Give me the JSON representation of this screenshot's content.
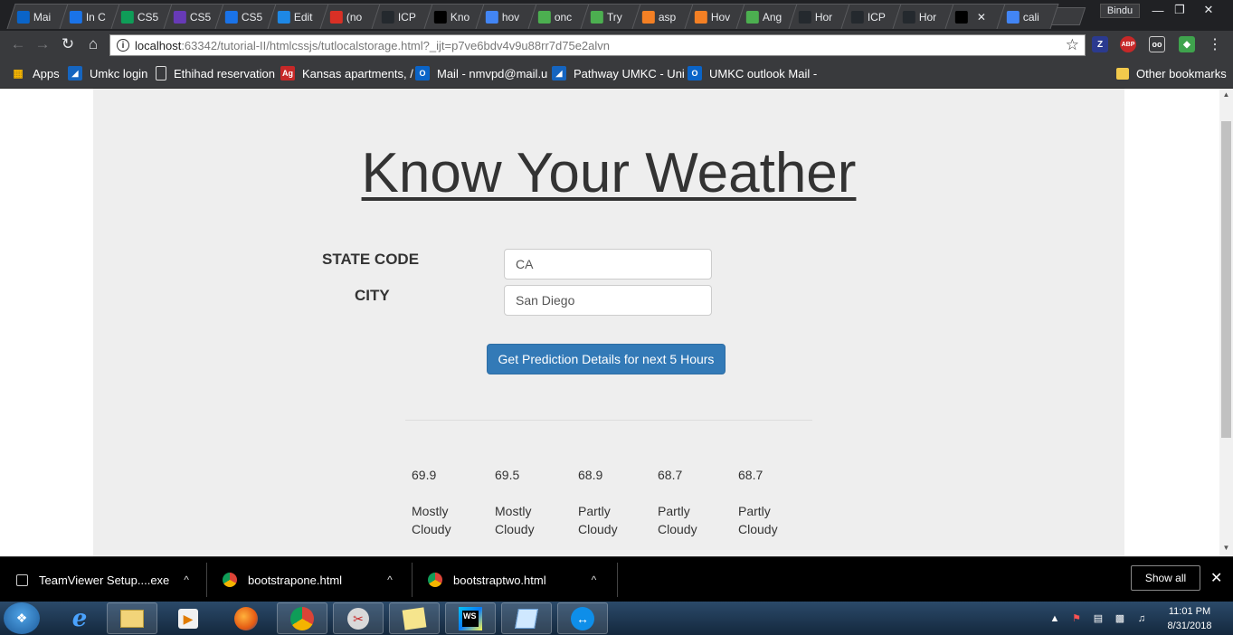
{
  "browser": {
    "tabs": [
      {
        "label": "Mai",
        "icon": "outlook-icon",
        "color": "#0a64c8"
      },
      {
        "label": "In C",
        "icon": "box-icon",
        "color": "#1a73e8"
      },
      {
        "label": "CS5",
        "icon": "sheets-icon",
        "color": "#0f9d58"
      },
      {
        "label": "CS5",
        "icon": "forms-icon",
        "color": "#673ab7"
      },
      {
        "label": "CS5",
        "icon": "box-icon",
        "color": "#1a73e8"
      },
      {
        "label": "Edit",
        "icon": "cloud-icon",
        "color": "#1e88e5"
      },
      {
        "label": "(no",
        "icon": "gmail-icon",
        "color": "#d93025"
      },
      {
        "label": "ICP",
        "icon": "github-icon",
        "color": "#24292e"
      },
      {
        "label": "Kno",
        "icon": "webstorm-icon",
        "color": "#000000"
      },
      {
        "label": "hov",
        "icon": "google-icon",
        "color": "#4285f4"
      },
      {
        "label": "onc",
        "icon": "w3schools-icon",
        "color": "#4caf50"
      },
      {
        "label": "Try",
        "icon": "w3schools-icon",
        "color": "#4caf50"
      },
      {
        "label": "asp",
        "icon": "stackoverflow-icon",
        "color": "#f48024"
      },
      {
        "label": "Hov",
        "icon": "stackoverflow-icon",
        "color": "#f48024"
      },
      {
        "label": "Ang",
        "icon": "w3schools-icon",
        "color": "#4caf50"
      },
      {
        "label": "Hor",
        "icon": "github-icon",
        "color": "#24292e"
      },
      {
        "label": "ICP",
        "icon": "github-icon",
        "color": "#24292e"
      },
      {
        "label": "Hor",
        "icon": "github-icon",
        "color": "#24292e"
      },
      {
        "label": "",
        "icon": "webstorm-icon",
        "color": "#000000",
        "active": true
      },
      {
        "label": "cali",
        "icon": "google-icon",
        "color": "#4285f4"
      }
    ],
    "profile_name": "Bindu",
    "url_host": "localhost",
    "url_rest": ":63342/tutorial-II/htmlcssjs/tutlocalstorage.html?_ijt=p7ve6bdv4v9u88rr7d75e2alvn",
    "bookmarks": [
      {
        "label": "Apps",
        "icon": "apps-icon"
      },
      {
        "label": "Umkc login",
        "icon": "umkc-icon"
      },
      {
        "label": "Ethihad reservation",
        "icon": "page-icon"
      },
      {
        "label": "Kansas apartments, /",
        "icon": "ag-icon"
      },
      {
        "label": "Mail - nmvpd@mail.u",
        "icon": "outlook-icon"
      },
      {
        "label": "Pathway UMKC - Uni",
        "icon": "umkc-icon"
      },
      {
        "label": "UMKC outlook Mail -",
        "icon": "outlook-icon"
      }
    ],
    "other_bookmarks": "Other bookmarks"
  },
  "page": {
    "title": "Know Your Weather",
    "state_label": "STATE CODE",
    "state_value": "CA",
    "city_label": "CITY",
    "city_value": "San Diego",
    "button_label": "Get Prediction Details for next 5 Hours",
    "forecast": [
      {
        "temp": "69.9",
        "condition": "Mostly Cloudy"
      },
      {
        "temp": "69.5",
        "condition": "Mostly Cloudy"
      },
      {
        "temp": "68.9",
        "condition": "Partly Cloudy"
      },
      {
        "temp": "68.7",
        "condition": "Partly Cloudy"
      },
      {
        "temp": "68.7",
        "condition": "Partly Cloudy"
      }
    ]
  },
  "downloads": {
    "items": [
      {
        "label": "TeamViewer Setup....exe"
      },
      {
        "label": "bootstrapone.html"
      },
      {
        "label": "bootstraptwo.html"
      }
    ],
    "show_all": "Show all"
  },
  "taskbar": {
    "time": "11:01 PM",
    "date": "8/31/2018"
  }
}
